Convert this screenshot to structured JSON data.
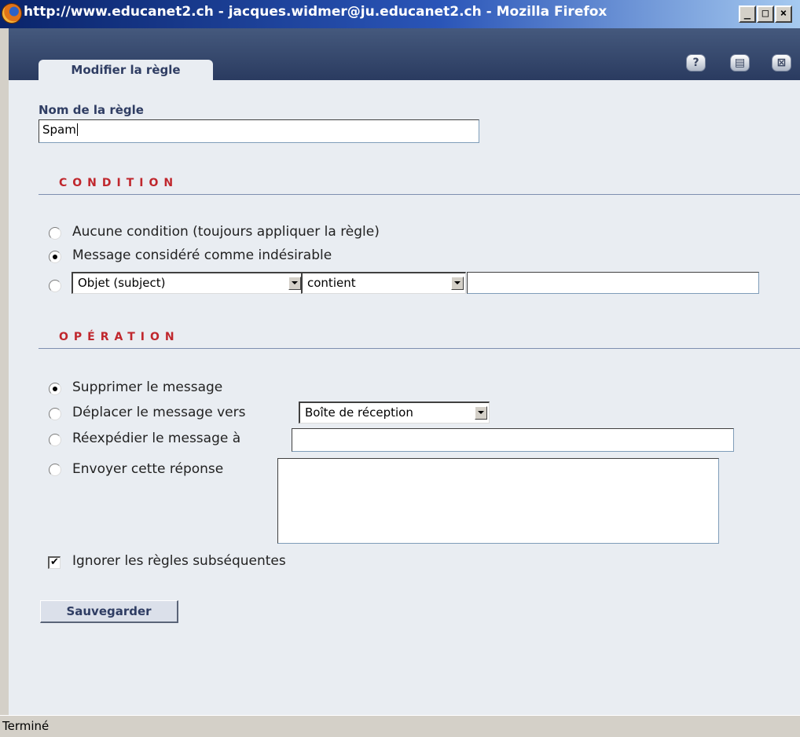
{
  "window": {
    "title": "http://www.educanet2.ch - jacques.widmer@ju.educanet2.ch - Mozilla Firefox",
    "browser_icon": "firefox-icon",
    "controls": {
      "minimize": "_",
      "maximize": "□",
      "close": "×"
    }
  },
  "header": {
    "tab_label": "Modifier la règle",
    "tool_icons": {
      "help": "?",
      "print": "▤",
      "close": "⊠"
    }
  },
  "form": {
    "rule_name_label": "Nom de la règle",
    "rule_name_value": "Spam",
    "condition": {
      "heading": "CONDITION",
      "options": [
        {
          "label": "Aucune condition (toujours appliquer la règle)",
          "selected": false
        },
        {
          "label": "Message considéré comme indésirable",
          "selected": true
        },
        {
          "label": "",
          "selected": false
        }
      ],
      "field_select": "Objet (subject)",
      "operator_select": "contient",
      "value": ""
    },
    "operation": {
      "heading": "OPÉRATION",
      "options": [
        {
          "label": "Supprimer le message",
          "selected": true
        },
        {
          "label": "Déplacer le message vers",
          "selected": false
        },
        {
          "label": "Réexpédier le message à",
          "selected": false
        },
        {
          "label": "Envoyer cette réponse",
          "selected": false
        }
      ],
      "folder_select": "Boîte de réception",
      "forward_address": "",
      "reply_text": ""
    },
    "ignore_subsequent": {
      "label": "Ignorer les règles subséquentes",
      "checked": true
    },
    "save_label": "Sauvegarder"
  },
  "status": {
    "text": "Terminé"
  },
  "colors": {
    "header_bg": "#2a3b60",
    "section_heading": "#c0272d",
    "label_text": "#2f3d63",
    "page_bg": "#e9edf2"
  }
}
